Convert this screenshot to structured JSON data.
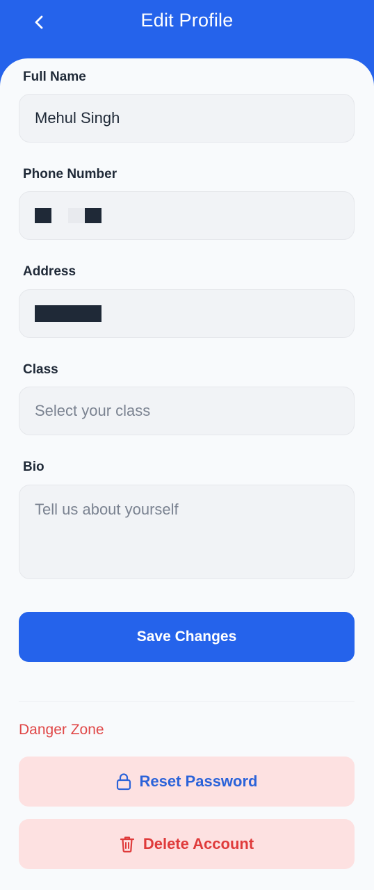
{
  "header": {
    "title": "Edit Profile",
    "back_icon": "chevron-left-icon"
  },
  "form": {
    "full_name": {
      "label": "Full Name",
      "value": "Mehul Singh"
    },
    "phone": {
      "label": "Phone Number",
      "value": ""
    },
    "address": {
      "label": "Address",
      "value": ""
    },
    "class": {
      "label": "Class",
      "placeholder": "Select your class"
    },
    "bio": {
      "label": "Bio",
      "placeholder": "Tell us about yourself"
    }
  },
  "save_button": {
    "label": "Save Changes"
  },
  "danger_zone": {
    "title": "Danger Zone",
    "reset_password": {
      "label": "Reset Password",
      "icon": "lock-icon"
    },
    "delete_account": {
      "label": "Delete Account",
      "icon": "trash-icon"
    }
  },
  "colors": {
    "primary": "#2563eb",
    "danger_text": "#e04848",
    "danger_bg": "#fde1e1",
    "field_bg": "#f1f3f6"
  }
}
